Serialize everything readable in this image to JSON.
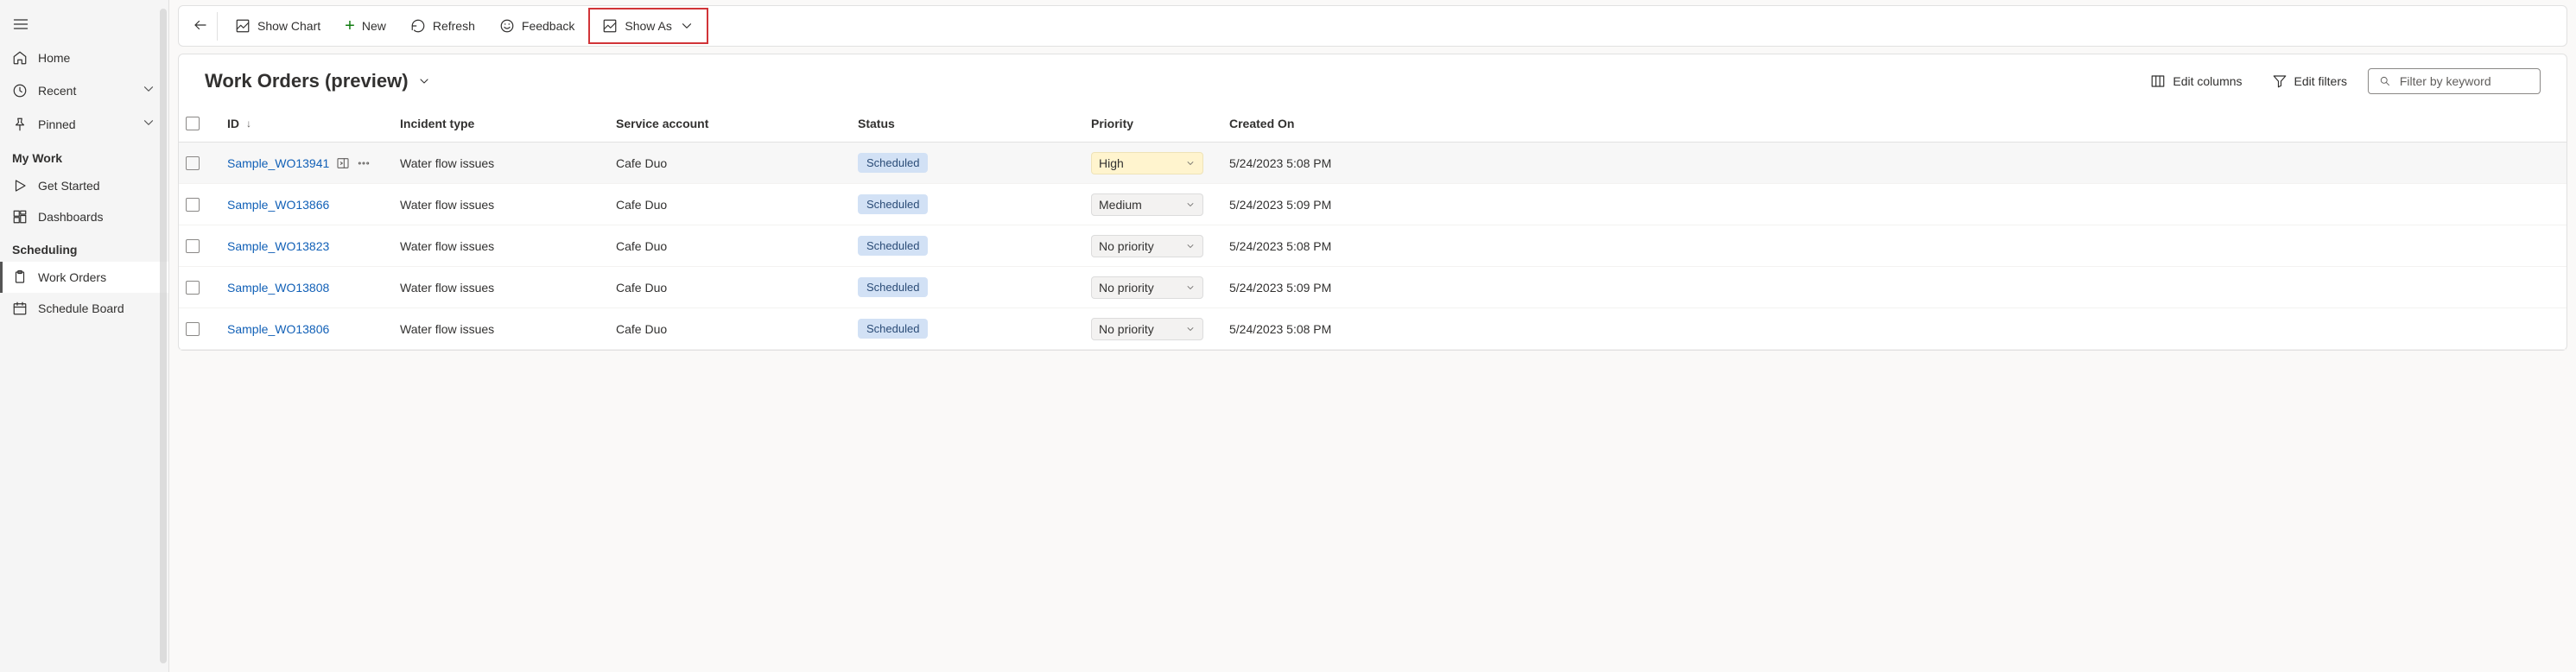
{
  "sidebar": {
    "top": [
      {
        "label": "Home",
        "icon": "home-icon"
      },
      {
        "label": "Recent",
        "icon": "clock-icon",
        "chevron": true
      },
      {
        "label": "Pinned",
        "icon": "pin-icon",
        "chevron": true
      }
    ],
    "sections": [
      {
        "title": "My Work",
        "items": [
          {
            "label": "Get Started",
            "icon": "play-icon"
          },
          {
            "label": "Dashboards",
            "icon": "dashboard-icon"
          }
        ]
      },
      {
        "title": "Scheduling",
        "items": [
          {
            "label": "Work Orders",
            "icon": "clipboard-icon",
            "active": true
          },
          {
            "label": "Schedule Board",
            "icon": "calendar-icon"
          }
        ]
      }
    ]
  },
  "cmdbar": {
    "show_chart": "Show Chart",
    "new": "New",
    "refresh": "Refresh",
    "feedback": "Feedback",
    "show_as": "Show As"
  },
  "view": {
    "title": "Work Orders (preview)",
    "edit_columns": "Edit columns",
    "edit_filters": "Edit filters",
    "filter_placeholder": "Filter by keyword"
  },
  "columns": {
    "id": "ID",
    "incident_type": "Incident type",
    "service_account": "Service account",
    "status": "Status",
    "priority": "Priority",
    "created_on": "Created On"
  },
  "rows": [
    {
      "id": "Sample_WO13941",
      "hover": true,
      "incident_type": "Water flow issues",
      "service_account": "Cafe Duo",
      "status": "Scheduled",
      "priority": "High",
      "priority_class": "high",
      "created_on": "5/24/2023 5:08 PM"
    },
    {
      "id": "Sample_WO13866",
      "incident_type": "Water flow issues",
      "service_account": "Cafe Duo",
      "status": "Scheduled",
      "priority": "Medium",
      "priority_class": "",
      "created_on": "5/24/2023 5:09 PM"
    },
    {
      "id": "Sample_WO13823",
      "incident_type": "Water flow issues",
      "service_account": "Cafe Duo",
      "status": "Scheduled",
      "priority": "No priority",
      "priority_class": "",
      "created_on": "5/24/2023 5:08 PM"
    },
    {
      "id": "Sample_WO13808",
      "incident_type": "Water flow issues",
      "service_account": "Cafe Duo",
      "status": "Scheduled",
      "priority": "No priority",
      "priority_class": "",
      "created_on": "5/24/2023 5:09 PM"
    },
    {
      "id": "Sample_WO13806",
      "incident_type": "Water flow issues",
      "service_account": "Cafe Duo",
      "status": "Scheduled",
      "priority": "No priority",
      "priority_class": "",
      "created_on": "5/24/2023 5:08 PM"
    }
  ]
}
